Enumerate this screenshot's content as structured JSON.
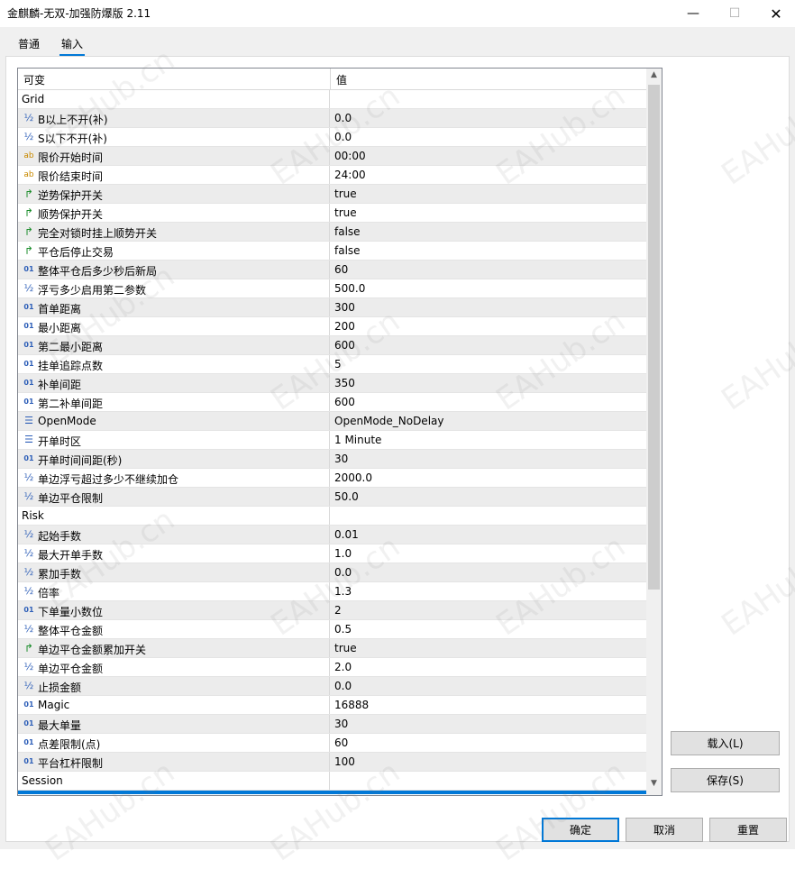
{
  "window": {
    "title": "金麒麟-无双-加强防爆版 2.11",
    "minimize_glyph": "—",
    "maximize_glyph": "☐",
    "close_glyph": "✕"
  },
  "tabs": [
    {
      "label": "普通",
      "active": false
    },
    {
      "label": "输入",
      "active": true
    }
  ],
  "table": {
    "col_variable": "可变",
    "col_value": "值",
    "rows": [
      {
        "type": "section",
        "name": "Grid",
        "value": ""
      },
      {
        "type": "half",
        "icon": "½",
        "name": "B以上不开(补)",
        "value": "0.0"
      },
      {
        "type": "half",
        "icon": "½",
        "name": "S以下不开(补)",
        "value": "0.0"
      },
      {
        "type": "str",
        "icon": "ab",
        "name": "限价开始时间",
        "value": "00:00"
      },
      {
        "type": "str",
        "icon": "ab",
        "name": "限价结束时间",
        "value": "24:00"
      },
      {
        "type": "bool",
        "icon": "↱",
        "name": "逆势保护开关",
        "value": "true"
      },
      {
        "type": "bool",
        "icon": "↱",
        "name": "顺势保护开关",
        "value": "true"
      },
      {
        "type": "bool",
        "icon": "↱",
        "name": "完全对锁时挂上顺势开关",
        "value": "false"
      },
      {
        "type": "bool",
        "icon": "↱",
        "name": "平仓后停止交易",
        "value": "false"
      },
      {
        "type": "int",
        "icon": "01",
        "name": "整体平仓后多少秒后新局",
        "value": "60"
      },
      {
        "type": "half",
        "icon": "½",
        "name": "浮亏多少启用第二参数",
        "value": "500.0"
      },
      {
        "type": "int",
        "icon": "01",
        "name": "首单距离",
        "value": "300"
      },
      {
        "type": "int",
        "icon": "01",
        "name": "最小距离",
        "value": "200"
      },
      {
        "type": "int",
        "icon": "01",
        "name": "第二最小距离",
        "value": "600"
      },
      {
        "type": "int",
        "icon": "01",
        "name": "挂单追踪点数",
        "value": "5"
      },
      {
        "type": "int",
        "icon": "01",
        "name": "补单间距",
        "value": "350"
      },
      {
        "type": "int",
        "icon": "01",
        "name": "第二补单间距",
        "value": "600"
      },
      {
        "type": "enum",
        "icon": "☰",
        "name": "OpenMode",
        "value": "OpenMode_NoDelay"
      },
      {
        "type": "enum",
        "icon": "☰",
        "name": "开单时区",
        "value": "1 Minute"
      },
      {
        "type": "int",
        "icon": "01",
        "name": "开单时间间距(秒)",
        "value": "30"
      },
      {
        "type": "half",
        "icon": "½",
        "name": "单边浮亏超过多少不继续加仓",
        "value": "2000.0"
      },
      {
        "type": "half",
        "icon": "½",
        "name": "单边平仓限制",
        "value": "50.0"
      },
      {
        "type": "section",
        "name": "Risk",
        "value": ""
      },
      {
        "type": "half",
        "icon": "½",
        "name": "起始手数",
        "value": "0.01"
      },
      {
        "type": "half",
        "icon": "½",
        "name": "最大开单手数",
        "value": "1.0"
      },
      {
        "type": "half",
        "icon": "½",
        "name": "累加手数",
        "value": "0.0"
      },
      {
        "type": "half",
        "icon": "½",
        "name": "倍率",
        "value": "1.3"
      },
      {
        "type": "int",
        "icon": "01",
        "name": "下单量小数位",
        "value": "2"
      },
      {
        "type": "half",
        "icon": "½",
        "name": "整体平仓金额",
        "value": "0.5"
      },
      {
        "type": "bool",
        "icon": "↱",
        "name": "单边平仓金额累加开关",
        "value": "true"
      },
      {
        "type": "half",
        "icon": "½",
        "name": "单边平仓金额",
        "value": "2.0"
      },
      {
        "type": "half",
        "icon": "½",
        "name": "止损金额",
        "value": "0.0"
      },
      {
        "type": "int",
        "icon": "01",
        "name": "Magic",
        "value": "16888"
      },
      {
        "type": "int",
        "icon": "01",
        "name": "最大单量",
        "value": "30"
      },
      {
        "type": "int",
        "icon": "01",
        "name": "点差限制(点)",
        "value": "60"
      },
      {
        "type": "int",
        "icon": "01",
        "name": "平台杠杆限制",
        "value": "100"
      },
      {
        "type": "section",
        "name": "Session",
        "value": ""
      }
    ]
  },
  "scroll": {
    "up_glyph": "▲",
    "down_glyph": "▼"
  },
  "buttons": {
    "load": "载入(L)",
    "save": "保存(S)",
    "ok": "确定",
    "cancel": "取消",
    "reset": "重置"
  },
  "watermark": "EAHub.cn",
  "colors": {
    "accent": "#0078d7",
    "row_alt": "#ececec"
  }
}
